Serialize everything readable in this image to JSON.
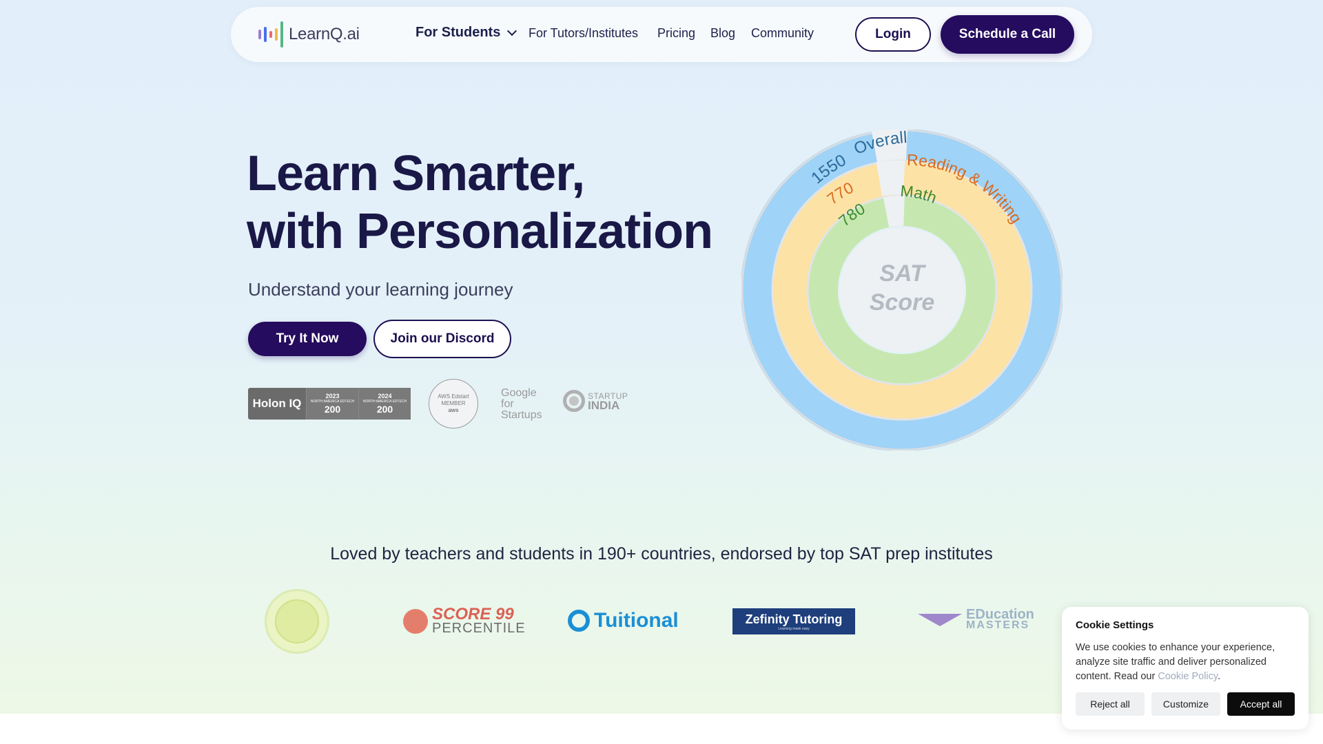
{
  "nav": {
    "logo_text_main": "LearnQ",
    "logo_text_suffix": ".ai",
    "logo_bar_colors": [
      "#9b7bd6",
      "#4a6ef0",
      "#e96a6a",
      "#f1b84b",
      "#55b784"
    ],
    "for_students": "For Students",
    "for_tutors": "For Tutors/Institutes",
    "pricing": "Pricing",
    "blog": "Blog",
    "community": "Community",
    "login": "Login",
    "schedule": "Schedule a Call"
  },
  "hero": {
    "title_line1": "Learn Smarter,",
    "title_line2": "with Personalization",
    "subtitle": "Understand your learning journey",
    "try_button": "Try It Now",
    "discord_button": "Join our Discord"
  },
  "badges": {
    "holon_name": "Holon IQ",
    "holon_cells": [
      {
        "year": "2023",
        "line": "NORTH AMERICA EDTECH",
        "value": "200"
      },
      {
        "year": "2024",
        "line": "NORTH AMERICA EDTECH",
        "value": "200"
      }
    ],
    "aws_line1": "AWS Edstart",
    "aws_line2": "MEMBER",
    "aws_line3": "aws",
    "google_line1": "Google",
    "google_line2": "for",
    "google_line3": "Startups",
    "startup_india_top": "STARTUP",
    "startup_india_bottom": "INDIA"
  },
  "donut": {
    "center_line1": "SAT",
    "center_line2": "Score",
    "rings": [
      {
        "name": "Overall",
        "score": "1550",
        "color": "#9fd3f7",
        "label_color": "#2a6a9a"
      },
      {
        "name": "Reading & Writing",
        "score": "770",
        "color": "#fde2a6",
        "label_color": "#d76a1e"
      },
      {
        "name": "Math",
        "score": "780",
        "color": "#c6e8b0",
        "label_color": "#3b8a2e"
      }
    ]
  },
  "social_proof": {
    "headline": "Loved by teachers and students in 190+ countries, endorsed by top SAT prep institutes",
    "score99_line1": "SCORE 99",
    "score99_line2": "PERCENTILE",
    "tuitional": "Tuitional",
    "zefinity_line1": "Zefinity Tutoring",
    "zefinity_line2": "Learning made easy",
    "edu_line1": "EDucation",
    "edu_line2": "MASTERS"
  },
  "cookie": {
    "title": "Cookie Settings",
    "body": "We use cookies to enhance your experience, analyze site traffic and deliver personalized content. Read our ",
    "link": "Cookie Policy",
    "period": ".",
    "reject": "Reject all",
    "customize": "Customize",
    "accept": "Accept all"
  }
}
